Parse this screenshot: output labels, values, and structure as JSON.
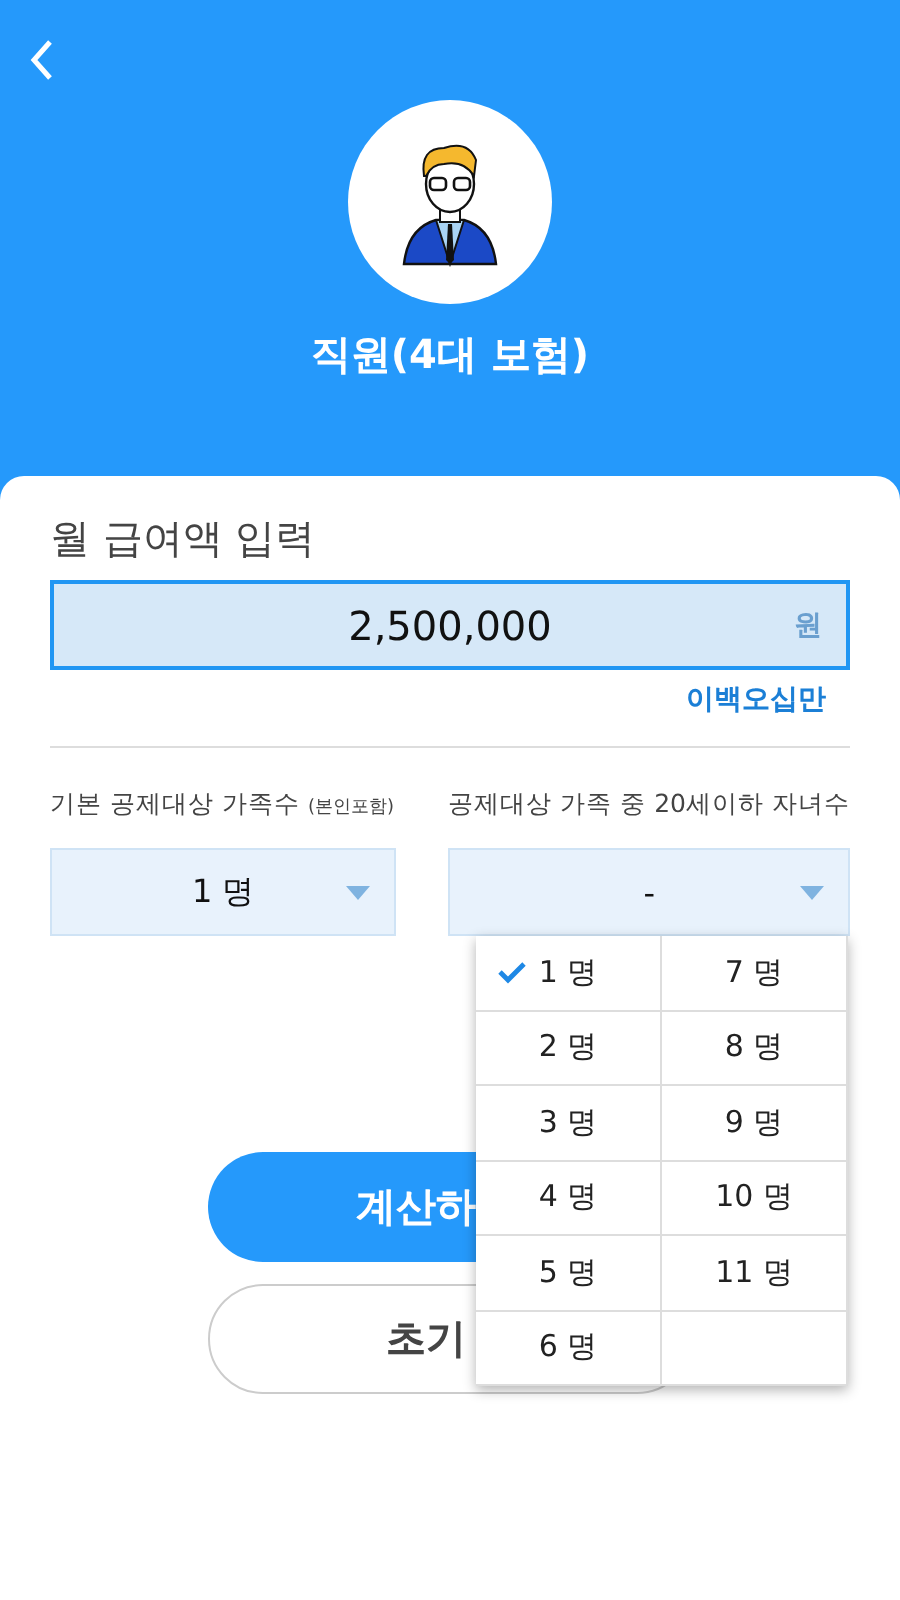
{
  "header": {
    "title": "직원(4대 보험)"
  },
  "salary": {
    "label": "월 급여액 입력",
    "value": "2,500,000",
    "unit": "원",
    "in_words": "이백오십만"
  },
  "dependents": {
    "label": "기본 공제대상 가족수",
    "note": "(본인포함)",
    "value": "1 명"
  },
  "children": {
    "label": "공제대상 가족 중 20세이하 자녀수",
    "value": "-"
  },
  "menu": [
    {
      "label": "1 명",
      "selected": true
    },
    {
      "label": "2 명",
      "selected": false
    },
    {
      "label": "3 명",
      "selected": false
    },
    {
      "label": "4 명",
      "selected": false
    },
    {
      "label": "5 명",
      "selected": false
    },
    {
      "label": "6 명",
      "selected": false
    },
    {
      "label": "7 명",
      "selected": false
    },
    {
      "label": "8 명",
      "selected": false
    },
    {
      "label": "9 명",
      "selected": false
    },
    {
      "label": "10 명",
      "selected": false
    },
    {
      "label": "11 명",
      "selected": false
    }
  ],
  "buttons": [
    {
      "kind": "primary",
      "label": "계산하"
    },
    {
      "kind": "outline",
      "label": "초기"
    }
  ]
}
